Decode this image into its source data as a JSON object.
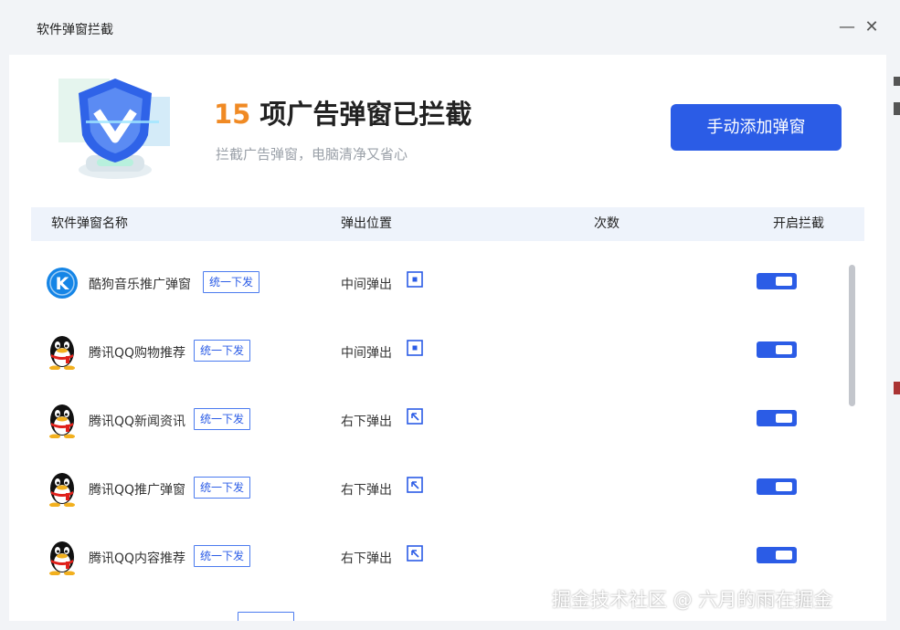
{
  "window": {
    "title": "软件弹窗拦截",
    "minimize": "—",
    "close": "✕"
  },
  "header": {
    "count": "15",
    "headline": "项广告弹窗已拦截",
    "subtitle": "拦截广告弹窗，电脑清净又省心",
    "manual_add_button": "手动添加弹窗"
  },
  "table": {
    "columns": [
      "软件弹窗名称",
      "弹出位置",
      "次数",
      "开启拦截"
    ],
    "rows": [
      {
        "icon": "kugou-icon",
        "name": "酷狗音乐推广弹窗",
        "tag": "统一下发",
        "position": "中间弹出",
        "position_icon": "center-popup-icon",
        "enabled": true
      },
      {
        "icon": "qq-penguin-icon",
        "name": "腾讯QQ购物推荐",
        "tag": "统一下发",
        "position": "中间弹出",
        "position_icon": "center-popup-icon",
        "enabled": true
      },
      {
        "icon": "qq-penguin-icon",
        "name": "腾讯QQ新闻资讯",
        "tag": "统一下发",
        "position": "右下弹出",
        "position_icon": "bottom-right-popup-icon",
        "enabled": true
      },
      {
        "icon": "qq-penguin-icon",
        "name": "腾讯QQ推广弹窗",
        "tag": "统一下发",
        "position": "右下弹出",
        "position_icon": "bottom-right-popup-icon",
        "enabled": true
      },
      {
        "icon": "qq-penguin-icon",
        "name": "腾讯QQ内容推荐",
        "tag": "统一下发",
        "position": "右下弹出",
        "position_icon": "bottom-right-popup-icon",
        "enabled": true
      }
    ]
  },
  "watermark": "掘金技术社区 @ 六月的雨在掘金",
  "colors": {
    "accent": "#2b5ce6",
    "count": "#f08a24",
    "header_bg": "#eef3fb"
  }
}
